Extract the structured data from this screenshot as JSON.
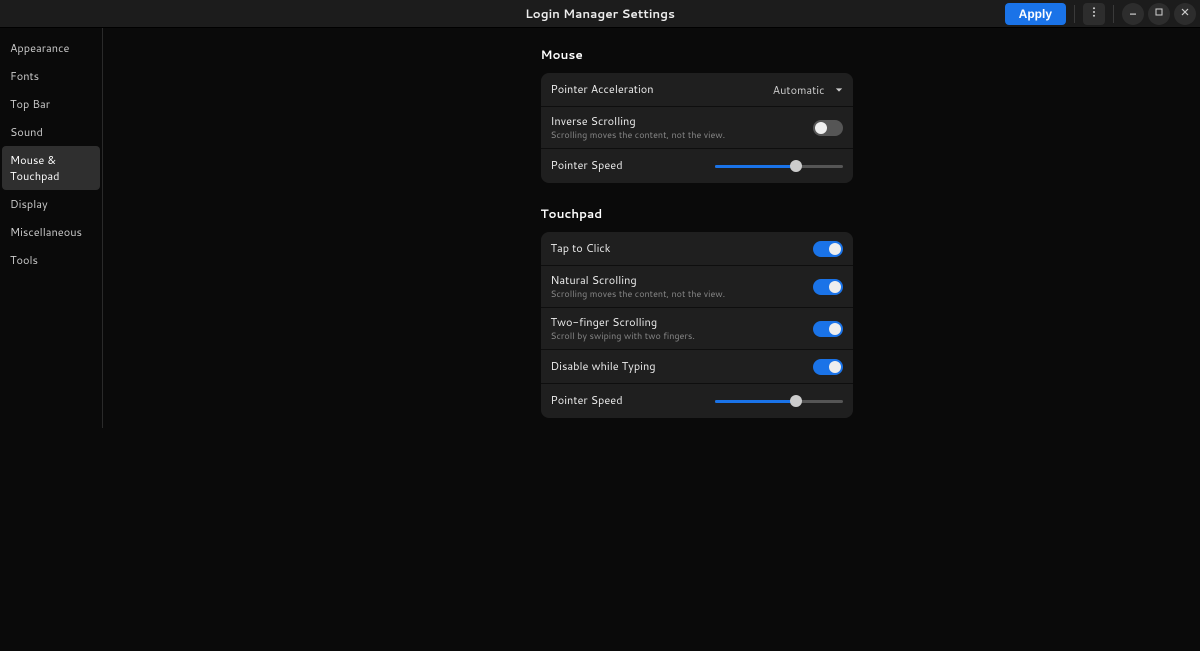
{
  "header": {
    "title": "Login Manager Settings",
    "apply_label": "Apply"
  },
  "sidebar": {
    "items": [
      {
        "label": "Appearance"
      },
      {
        "label": "Fonts"
      },
      {
        "label": "Top Bar"
      },
      {
        "label": "Sound"
      },
      {
        "label": "Mouse & Touchpad",
        "active": true
      },
      {
        "label": "Display"
      },
      {
        "label": "Miscellaneous"
      },
      {
        "label": "Tools"
      }
    ]
  },
  "mouse": {
    "heading": "Mouse",
    "pointer_accel": {
      "label": "Pointer Acceleration",
      "value": "Automatic"
    },
    "inverse_scroll": {
      "label": "Inverse Scrolling",
      "sub": "Scrolling moves the content, not the view.",
      "on": false
    },
    "pointer_speed": {
      "label": "Pointer Speed",
      "value": 0.64
    }
  },
  "touchpad": {
    "heading": "Touchpad",
    "tap_to_click": {
      "label": "Tap to Click",
      "on": true
    },
    "natural_scroll": {
      "label": "Natural Scrolling",
      "sub": "Scrolling moves the content, not the view.",
      "on": true
    },
    "two_finger": {
      "label": "Two-finger Scrolling",
      "sub": "Scroll by swiping with two fingers.",
      "on": true
    },
    "disable_typing": {
      "label": "Disable while Typing",
      "on": true
    },
    "pointer_speed": {
      "label": "Pointer Speed",
      "value": 0.64
    }
  },
  "colors": {
    "accent": "#1a73e8"
  }
}
